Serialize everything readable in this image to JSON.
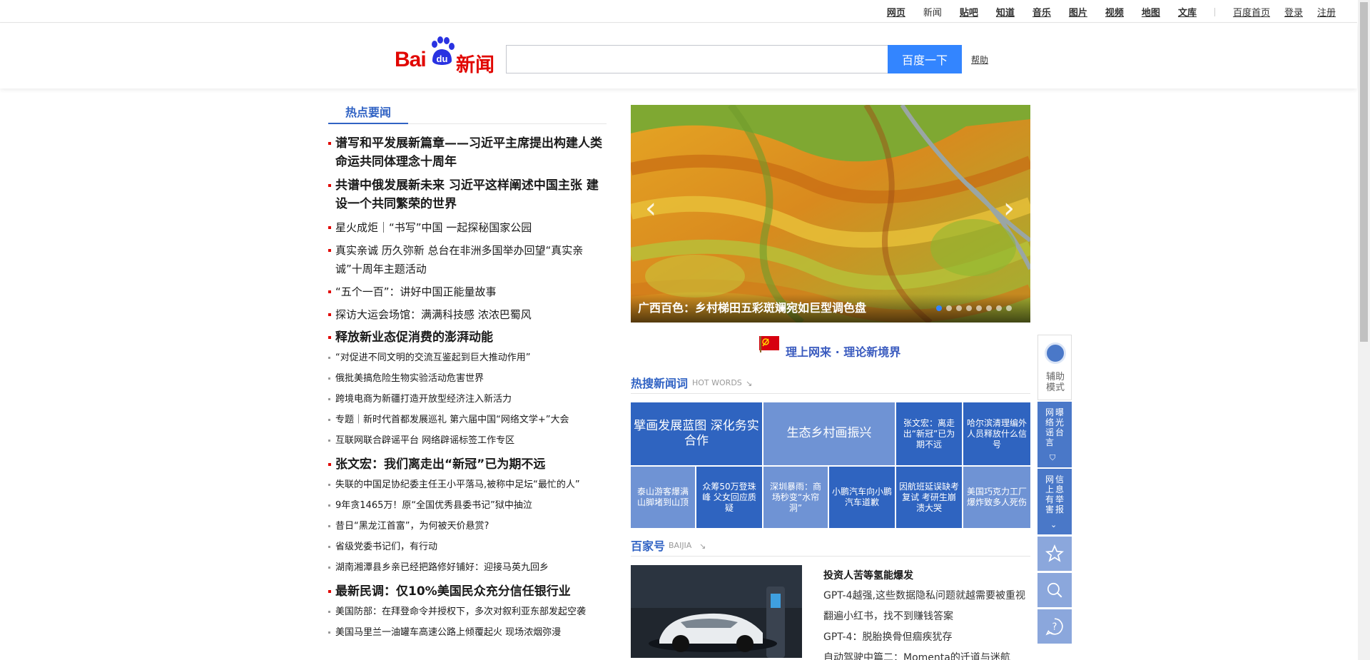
{
  "topnav": {
    "links": [
      "网页",
      "新闻",
      "贴吧",
      "知道",
      "音乐",
      "图片",
      "视频",
      "地图",
      "文库"
    ],
    "home": "百度首页",
    "login": "登录",
    "register": "注册"
  },
  "header": {
    "logo_bai": "Bai",
    "logo_du": "du",
    "logo_xw": "新闻",
    "search_value": "",
    "search_button": "百度一下",
    "help": "帮助"
  },
  "left": {
    "tab": "热点要闻",
    "items": [
      {
        "text": "谱写和平发展新篇章——习近平主席提出构建人类命运共同体理念十周年",
        "style": "big"
      },
      {
        "text": "共谱中俄发展新未来 习近平这样阐述中国主张 建设一个共同繁荣的世界",
        "style": "big"
      },
      {
        "text": "星火成炬｜“书写”中国 一起探秘国家公园",
        "style": "mid"
      },
      {
        "text": "真实亲诚 历久弥新 总台在非洲多国举办回望“真实亲诚”十周年主题活动",
        "style": "mid"
      },
      {
        "text": "“五个一百”：讲好中国正能量故事",
        "style": "mid"
      },
      {
        "text": "探访大运会场馆：满满科技感 浓浓巴蜀风",
        "style": "mid"
      },
      {
        "text": "释放新业态促消费的澎湃动能",
        "style": "big"
      },
      {
        "text": "“对促进不同文明的交流互鉴起到巨大推动作用”",
        "style": "small"
      },
      {
        "text": "俄批美搞危险生物实验活动危害世界",
        "style": "small"
      },
      {
        "text": "跨境电商为新疆打造开放型经济注入新活力",
        "style": "small"
      },
      {
        "text": "专题｜新时代首都发展巡礼 第六届中国“网络文学+”大会",
        "style": "small"
      },
      {
        "text": "互联网联合辟谣平台 网络辟谣标签工作专区",
        "style": "small"
      },
      {
        "text": "张文宏：我们离走出“新冠”已为期不远",
        "style": "big"
      },
      {
        "text": "失联的中国足协纪委主任王小平落马,被称中足坛“最忙的人”",
        "style": "small"
      },
      {
        "text": "9年贪1465万！原“全国优秀县委书记”狱中抽泣",
        "style": "small"
      },
      {
        "text": "昔日“黑龙江首富”，为何被天价悬赏?",
        "style": "small"
      },
      {
        "text": "省级党委书记们，有行动",
        "style": "small"
      },
      {
        "text": "湖南湘潭县乡亲已经把路修好铺好：迎接马英九回乡",
        "style": "small"
      },
      {
        "text": "最新民调：仅10%美国民众充分信任银行业",
        "style": "big"
      },
      {
        "text": "美国防部：在拜登命令并授权下，多次对叙利亚东部发起空袭",
        "style": "small"
      },
      {
        "text": "美国马里兰一油罐车高速公路上倾覆起火 现场浓烟弥漫",
        "style": "small"
      }
    ]
  },
  "carousel": {
    "caption": "广西百色：乡村梯田五彩斑斓宛如巨型调色盘",
    "prev": "‹",
    "next": "›",
    "slide_count": 8,
    "active_index": 0
  },
  "banner": {
    "text": "理上网来 · 理论新境界"
  },
  "hot_search": {
    "title": "热搜新闻词",
    "en": "HOT WORDS",
    "cells": [
      "擘画发展蓝图 深化务实合作",
      "生态乡村画振兴",
      "张文宏：离走出“新冠”已为期不远",
      "哈尔滨清理编外人员释放什么信号",
      "泰山游客爆满 山脚堵到山顶",
      "众筹50万登珠峰 父女回应质疑",
      "深圳暴雨：商场秒变“水帘洞”",
      "小鹏汽车向小鹏汽车道歉",
      "因航班延误缺考复试 考研生崩溃大哭",
      "美国巧克力工厂爆炸致多人死伤"
    ]
  },
  "baijia": {
    "title": "百家号",
    "en": "BAIJIA",
    "headline": "投资人苦等氢能爆发",
    "lines": [
      "GPT-4越强,这些数据隐私问题就越需要被重视",
      "翻遍小红书，找不到赚钱答案",
      "GPT-4：脱胎换骨但痼疾犹存",
      "自动驾驶中篇二：Momenta的迁道与迷航"
    ]
  },
  "float_bar": {
    "assist": "辅助模式",
    "rumor": [
      "网络谣言",
      "曝光台"
    ],
    "report": [
      "网上有害",
      "信息举报"
    ]
  },
  "colors": {
    "accent": "#3163c4",
    "search_button": "#3385ff",
    "brand_red": "#e10601"
  }
}
